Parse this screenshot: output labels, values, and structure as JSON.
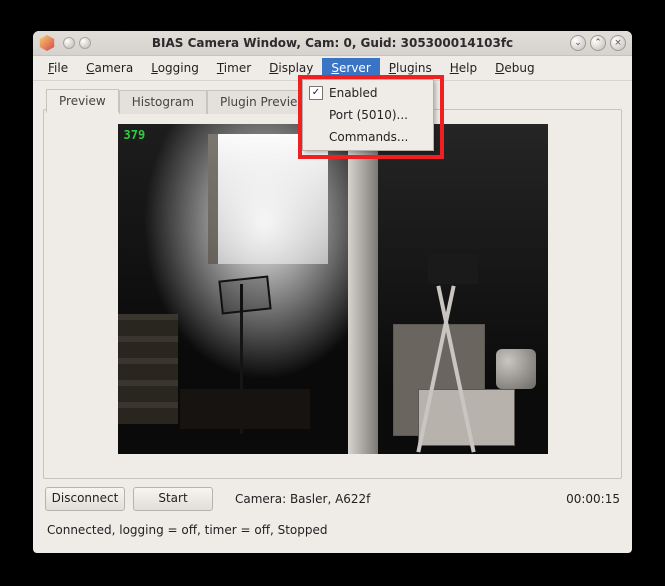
{
  "titlebar": {
    "title": "BIAS Camera Window, Cam: 0, Guid: 305300014103fc"
  },
  "menu": {
    "file": "File",
    "camera": "Camera",
    "logging": "Logging",
    "timer": "Timer",
    "display": "Display",
    "server": "Server",
    "plugins": "Plugins",
    "help": "Help",
    "debug": "Debug",
    "active": "server"
  },
  "server_menu": {
    "enabled": {
      "label": "Enabled",
      "checked": true
    },
    "port": {
      "label": "Port (5010)..."
    },
    "commands": {
      "label": "Commands..."
    }
  },
  "tabs": {
    "preview": "Preview",
    "histogram": "Histogram",
    "plugin_preview": "Plugin Preview",
    "active": "preview"
  },
  "preview": {
    "frame_counter": "379"
  },
  "controls": {
    "disconnect": "Disconnect",
    "start": "Start",
    "camera_label": "Camera:  Basler,  A622f",
    "elapsed": "00:00:15"
  },
  "status": "Connected, logging = off, timer = off, Stopped",
  "colors": {
    "menu_highlight": "#3a74c4",
    "annotation_box": "#f02020",
    "frame_counter": "#2ecc40"
  }
}
